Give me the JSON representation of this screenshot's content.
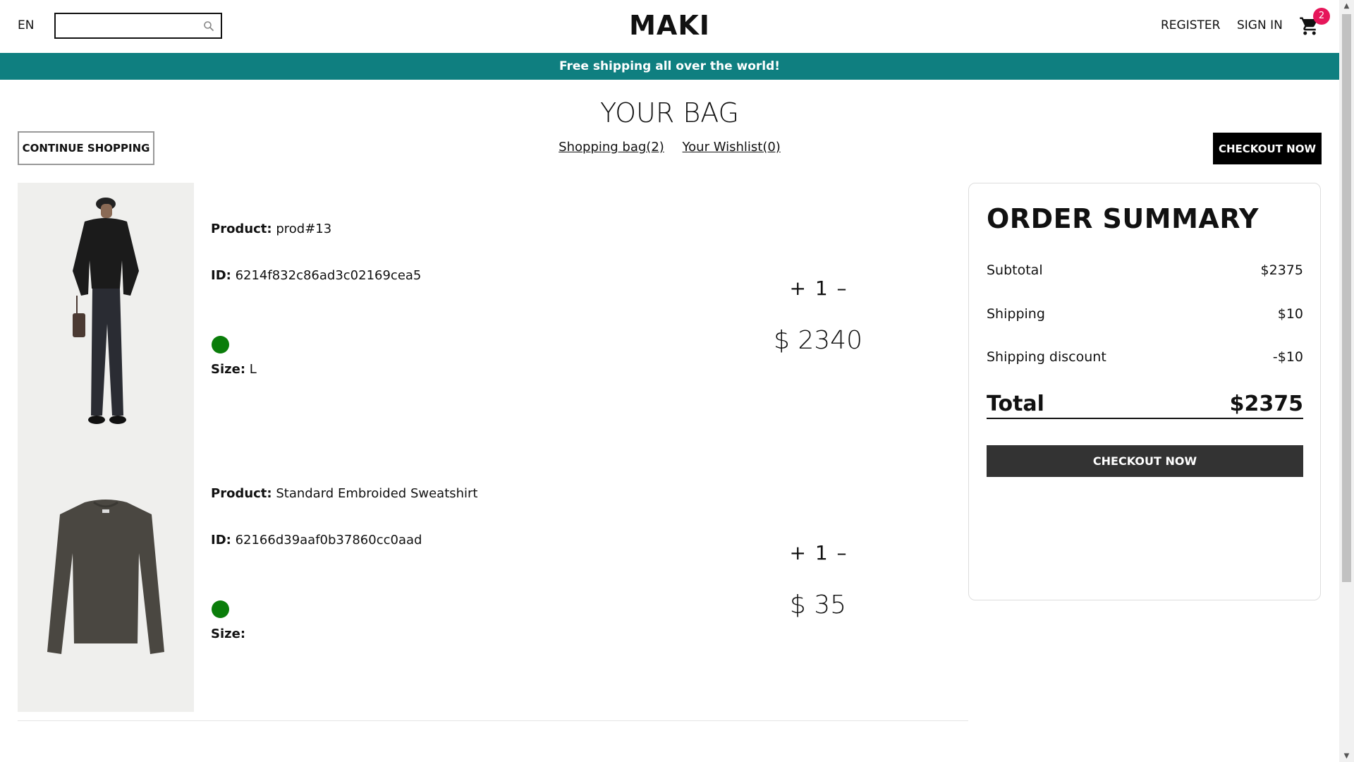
{
  "header": {
    "language": "EN",
    "search_placeholder": "",
    "logo": "MAKI",
    "register_label": "REGISTER",
    "signin_label": "SIGN IN",
    "cart_count": "2"
  },
  "banner": {
    "text": "Free shipping all over the world!"
  },
  "page": {
    "title": "YOUR BAG",
    "continue_label": "CONTINUE SHOPPING",
    "tab_bag": "Shopping bag(2)",
    "tab_wishlist": "Your Wishlist(0)",
    "checkout_label": "CHECKOUT NOW"
  },
  "products": [
    {
      "product_label": "Product:",
      "product_name": " prod#13",
      "id_label": "ID:",
      "id_value": " 6214f832c86ad3c02169cea5",
      "color": "#0a7d0a",
      "size_label": "Size:",
      "size_value": " L",
      "plus": "+",
      "quantity": "1",
      "minus": "–",
      "price": "$ 2340"
    },
    {
      "product_label": "Product:",
      "product_name": " Standard Embroided Sweatshirt",
      "id_label": "ID:",
      "id_value": " 62166d39aaf0b37860cc0aad",
      "color": "#0a7d0a",
      "size_label": "Size:",
      "size_value": "",
      "plus": "+",
      "quantity": "1",
      "minus": "–",
      "price": "$ 35"
    }
  ],
  "summary": {
    "title": "ORDER SUMMARY",
    "subtotal_label": "Subtotal",
    "subtotal_value": "$2375",
    "shipping_label": "Shipping",
    "shipping_value": "$10",
    "discount_label": "Shipping discount",
    "discount_value": "-$10",
    "total_label": "Total",
    "total_value": "$2375",
    "checkout_label": "CHECKOUT NOW"
  },
  "colors": {
    "banner": "#0f7f80",
    "badge": "#e6165a",
    "summary_button": "#333333"
  }
}
